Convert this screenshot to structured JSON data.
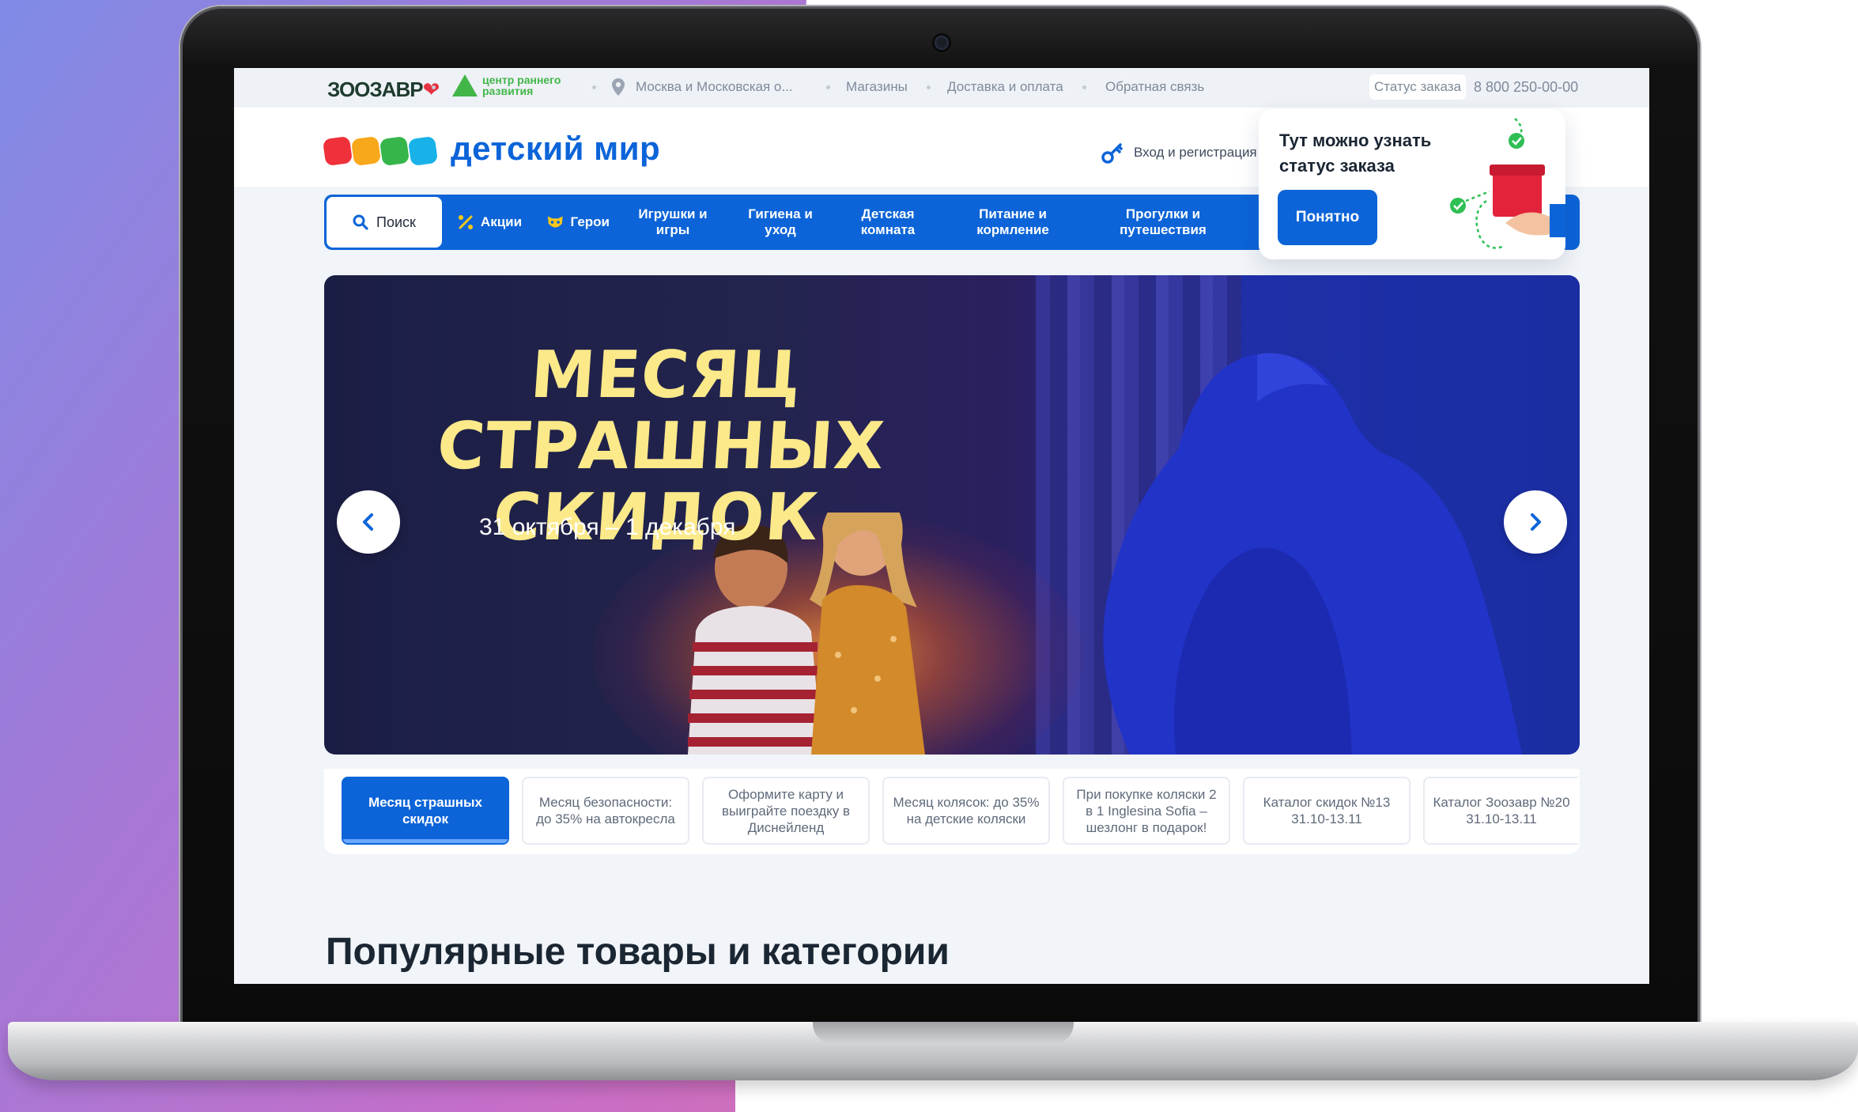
{
  "topbar": {
    "zoo_logo": "ЗООЗАВР",
    "crr_logo": "центр раннего развития",
    "city": "Москва и Московская о...",
    "links": [
      "Магазины",
      "Доставка и оплата",
      "Обратная связь"
    ],
    "order_status": "Статус заказа",
    "phone": "8 800 250-00-00"
  },
  "header": {
    "logo": "детский мир",
    "login": "Вход и регистрация"
  },
  "nav": {
    "search": "Поиск",
    "promo": "Акции",
    "heroes": "Герои",
    "categories": [
      "Игрушки и игры",
      "Гигиена и уход",
      "Детская комната",
      "Питание и кормление",
      "Прогулки и путешествия"
    ]
  },
  "tooltip": {
    "title": "Тут можно узнать статус заказа",
    "button": "Понятно"
  },
  "hero": {
    "title_line1": "Месяц страшных",
    "title_line2": "скидок",
    "date": "31 октября – 1 декабря"
  },
  "promo_tabs": [
    "Месяц страшных скидок",
    "Месяц безопасности: до 35% на автокресла",
    "Оформите карту и выиграйте поездку в Диснейленд",
    "Месяц колясок: до 35% на детские коляски",
    "При покупке коляски 2 в 1 Inglesina Sofia – шезлонг в подарок!",
    "Каталог скидок №13 31.10-13.11",
    "Каталог Зоозавр №20 31.10-13.11"
  ],
  "section": {
    "title": "Популярные товары и категории"
  },
  "colors": {
    "brand_blue": "#0c64d8",
    "logo_red": "#f0303a",
    "logo_orange": "#f7a81b",
    "logo_green": "#36b54a",
    "logo_cyan": "#19b2e8",
    "hero_title": "#fbe98a"
  }
}
